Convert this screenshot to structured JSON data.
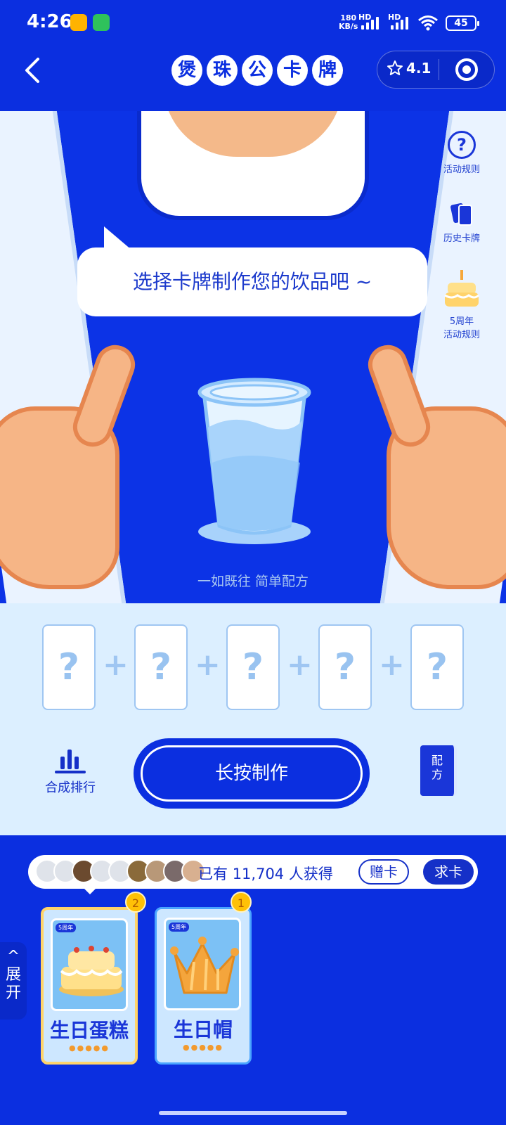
{
  "status_bar": {
    "time": "4:26",
    "net_speed_value": "180",
    "net_speed_unit": "KB/s",
    "signal1": "HD",
    "signal2": "HD",
    "battery": "45"
  },
  "nav": {
    "brand_chars": [
      "煲",
      "珠",
      "公",
      "卡",
      "牌"
    ],
    "rating": "4.1"
  },
  "side_menu": {
    "rules_label": "活动规则",
    "history_label": "历史卡牌",
    "anniversary_line1": "5周年",
    "anniversary_line2": "活动规则"
  },
  "speech_bubble": "选择卡牌制作您的饮品吧 ~",
  "slogan": "一如既往 简单配方",
  "slots": [
    "?",
    "?",
    "?",
    "?",
    "?"
  ],
  "plus_sign": "+",
  "rank_label": "合成排行",
  "make_button": "长按制作",
  "recipe_book": {
    "line1": "配",
    "line2": "方"
  },
  "obtained": {
    "prefix": "已有",
    "count": "11,704",
    "suffix": "人获得",
    "give_label": "赠卡",
    "ask_label": "求卡"
  },
  "expand": {
    "line1": "展",
    "line2": "开"
  },
  "cards": [
    {
      "name": "生日蛋糕",
      "count": "2",
      "tag": "5周年",
      "selected": true
    },
    {
      "name": "生日帽",
      "count": "1",
      "tag": "5周年",
      "selected": false
    }
  ],
  "card_drops": "●●●●●",
  "colors": {
    "primary_blue": "#0b2fe0",
    "counter_light": "#dcefff",
    "badge_yellow": "#ffc107",
    "card_bg": "#7cc1f5"
  },
  "icons": [
    "chevron-left-icon",
    "star-icon",
    "target-icon",
    "question-icon",
    "cards-icon",
    "cake-icon",
    "rank-bars-icon",
    "book-icon"
  ]
}
